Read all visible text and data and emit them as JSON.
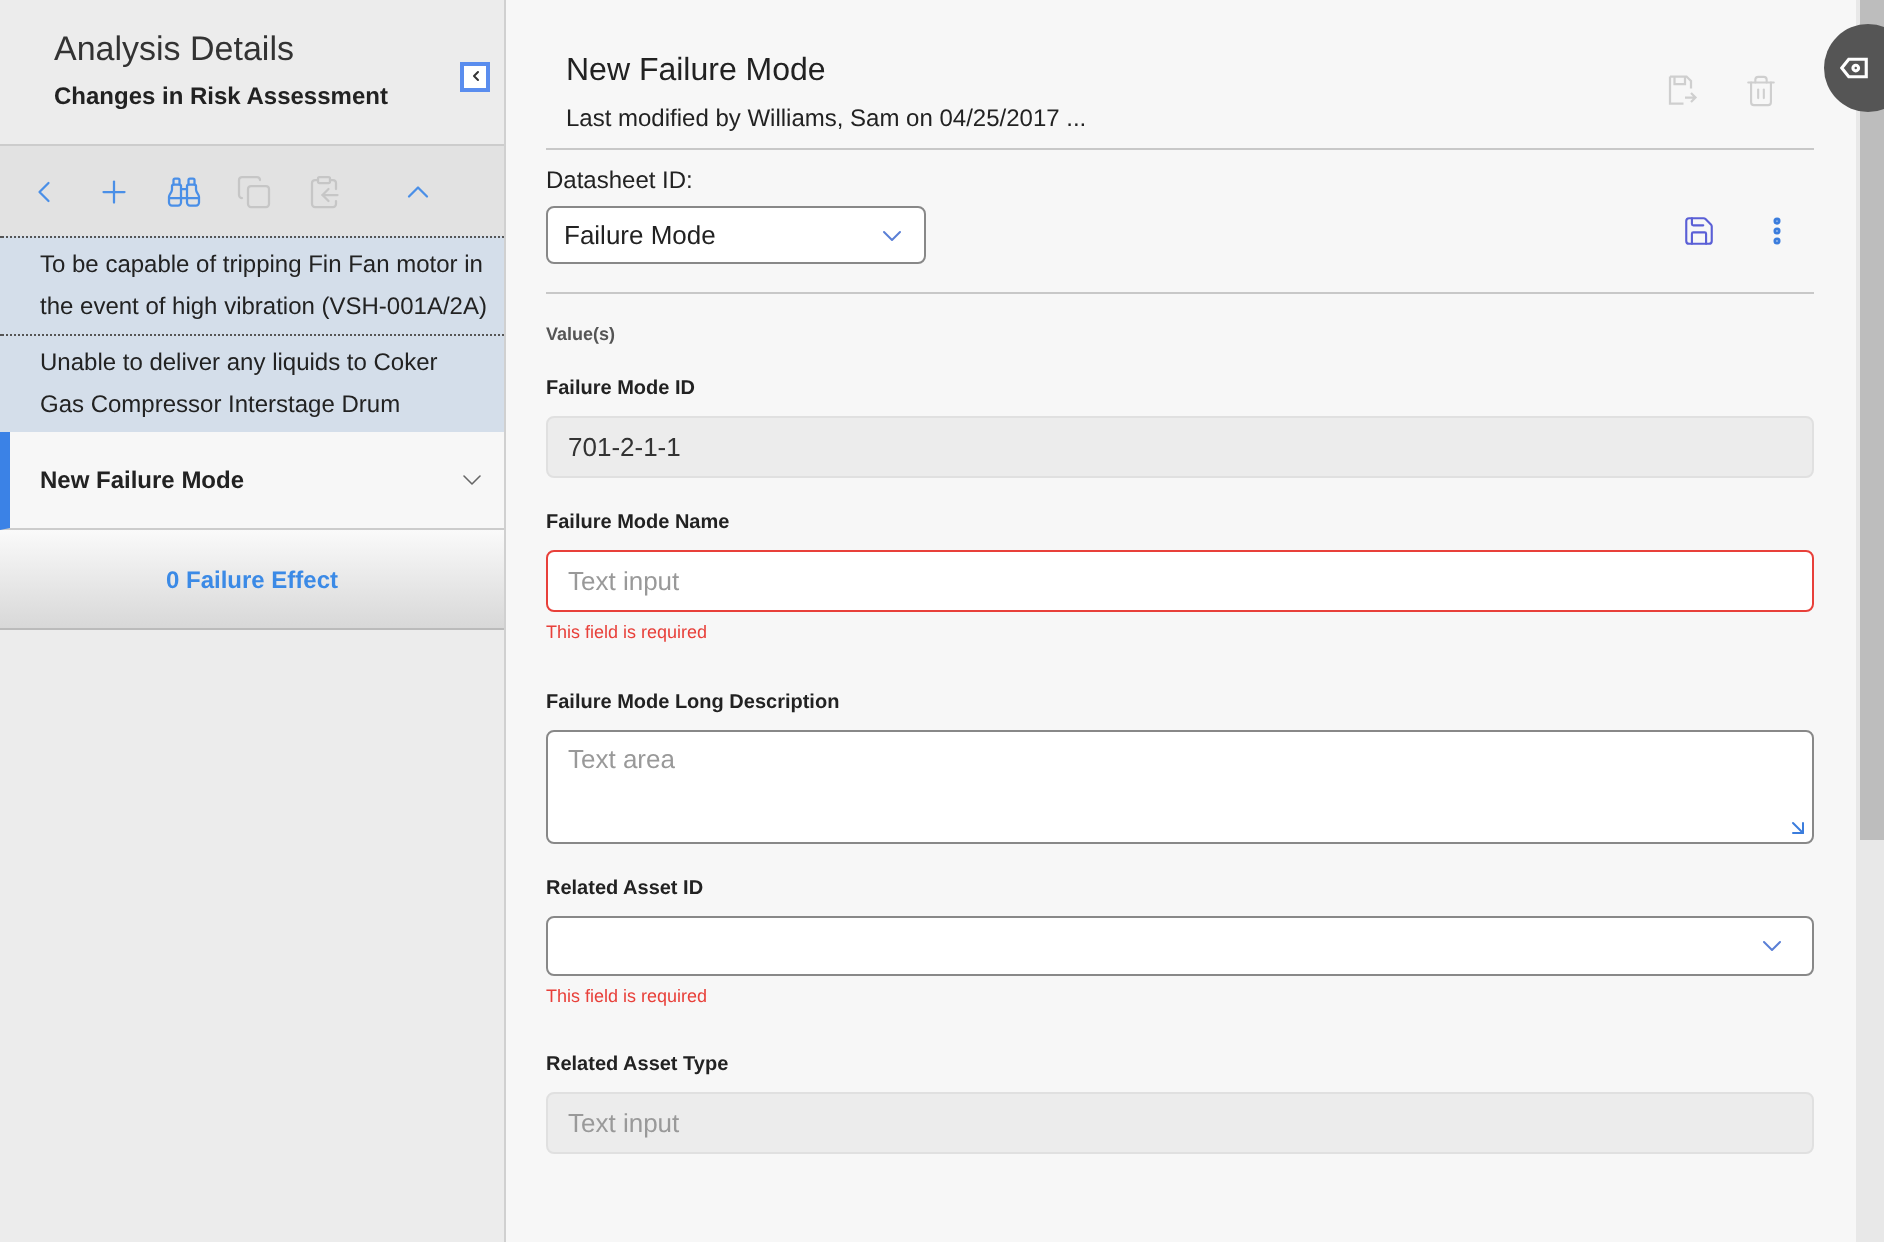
{
  "sidebar": {
    "title": "Analysis Details",
    "subtitle": "Changes in Risk Assessment",
    "toolbar": [
      {
        "kind": "back",
        "disabled": false
      },
      {
        "kind": "add",
        "disabled": false
      },
      {
        "kind": "find",
        "disabled": false
      },
      {
        "kind": "copy",
        "disabled": true
      },
      {
        "kind": "paste",
        "disabled": true
      },
      {
        "kind": "collapse",
        "disabled": false
      }
    ],
    "items": [
      {
        "label": "To be capable of tripping Fin Fan motor in the event of high vibration (VSH-001A/2A)",
        "selected": false
      },
      {
        "label": "Unable to deliver any liquids to Coker Gas Compressor Interstage Drum",
        "selected": false
      },
      {
        "label": "New Failure Mode",
        "selected": true
      }
    ],
    "footer_link": "0 Failure Effect"
  },
  "record": {
    "title": "New Failure Mode",
    "subtitle": "Last modified by Williams, Sam on 04/25/2017 ...",
    "header_actions": [
      {
        "kind": "save-as",
        "disabled": true
      },
      {
        "kind": "delete",
        "disabled": true
      }
    ],
    "datasheet_label": "Datasheet ID:",
    "datasheet_value": "Failure Mode",
    "section_label": "Value(s)",
    "fields": [
      {
        "kind": "readonly",
        "label": "Failure Mode ID",
        "value": "701-2-1-1"
      },
      {
        "kind": "text",
        "label": "Failure Mode Name",
        "placeholder": "Text input",
        "error": "This field is required"
      },
      {
        "kind": "textarea",
        "label": "Failure Mode Long Description",
        "placeholder": "Text area"
      },
      {
        "kind": "select",
        "label": "Related Asset ID",
        "error": "This field is required"
      },
      {
        "kind": "readonly",
        "label": "Related Asset Type",
        "placeholder": "Text input"
      }
    ]
  }
}
